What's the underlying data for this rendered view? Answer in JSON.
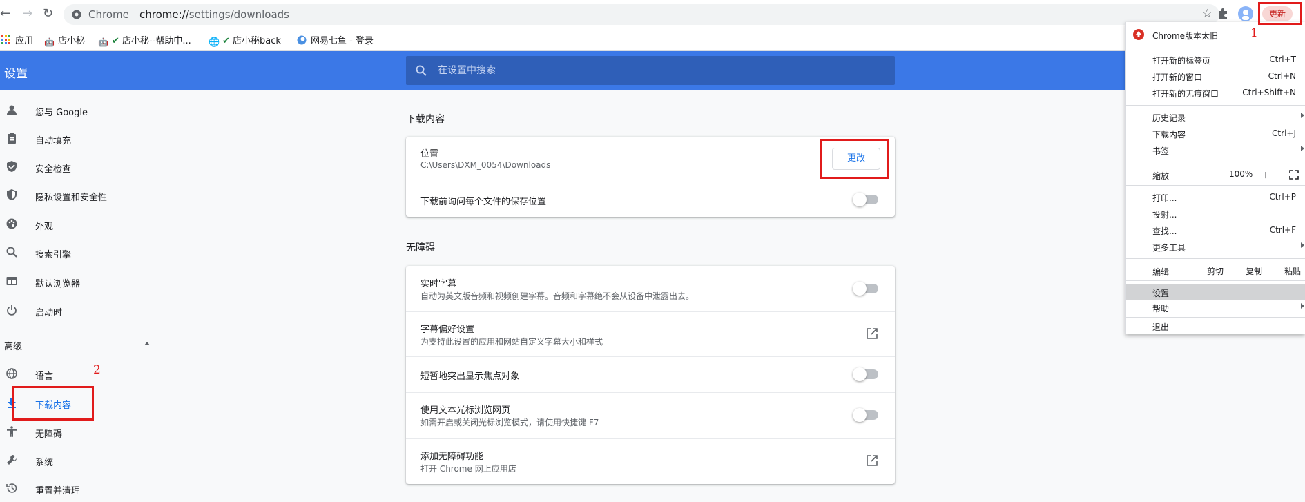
{
  "browser": {
    "site_label": "Chrome",
    "url_host": "chrome://",
    "url_path": "settings/downloads",
    "update_label": "更新"
  },
  "bookmarks": [
    {
      "label": "应用"
    },
    {
      "label": "店小秘"
    },
    {
      "label": "店小秘--帮助中..."
    },
    {
      "label": "店小秘back"
    },
    {
      "label": "网易七鱼 - 登录"
    }
  ],
  "header": {
    "title": "设置",
    "search_placeholder": "在设置中搜索"
  },
  "sidebar": {
    "items": [
      {
        "label": "您与 Google",
        "icon": "person-icon"
      },
      {
        "label": "自动填充",
        "icon": "clipboard-icon"
      },
      {
        "label": "安全检查",
        "icon": "shield-check-icon"
      },
      {
        "label": "隐私设置和安全性",
        "icon": "shield-icon"
      },
      {
        "label": "外观",
        "icon": "palette-icon"
      },
      {
        "label": "搜索引擎",
        "icon": "search-icon"
      },
      {
        "label": "默认浏览器",
        "icon": "browser-icon"
      },
      {
        "label": "启动时",
        "icon": "power-icon"
      }
    ],
    "advanced_label": "高级",
    "advanced_items": [
      {
        "label": "语言",
        "icon": "globe-icon"
      },
      {
        "label": "下载内容",
        "icon": "download-icon",
        "active": true
      },
      {
        "label": "无障碍",
        "icon": "accessibility-icon"
      },
      {
        "label": "系统",
        "icon": "wrench-icon"
      },
      {
        "label": "重置并清理",
        "icon": "history-icon"
      }
    ]
  },
  "downloads": {
    "section_title": "下载内容",
    "location_title": "位置",
    "location_path": "C:\\Users\\DXM_0054\\Downloads",
    "change_label": "更改",
    "ask_label": "下载前询问每个文件的保存位置"
  },
  "accessibility": {
    "section_title": "无障碍",
    "rows": [
      {
        "title": "实时字幕",
        "sub": "自动为英文版音频和视频创建字幕。音频和字幕绝不会从设备中泄露出去。",
        "control": "toggle"
      },
      {
        "title": "字幕偏好设置",
        "sub": "为支持此设置的应用和网站自定义字幕大小和样式",
        "control": "external"
      },
      {
        "title": "短暂地突出显示焦点对象",
        "sub": "",
        "control": "toggle"
      },
      {
        "title": "使用文本光标浏览网页",
        "sub": "如需开启或关闭光标浏览模式，请使用快捷键 F7",
        "control": "toggle"
      },
      {
        "title": "添加无障碍功能",
        "sub": "打开 Chrome 网上应用店",
        "control": "external"
      }
    ]
  },
  "menu": {
    "update_notice": "Chrome版本太旧",
    "new_tab": "打开新的标签页",
    "new_tab_sc": "Ctrl+T",
    "new_window": "打开新的窗口",
    "new_window_sc": "Ctrl+N",
    "incognito": "打开新的无痕窗口",
    "incognito_sc": "Ctrl+Shift+N",
    "history": "历史记录",
    "downloads": "下载内容",
    "downloads_sc": "Ctrl+J",
    "bookmarks": "书签",
    "zoom": "缩放",
    "zoom_minus": "－",
    "zoom_value": "100%",
    "zoom_plus": "＋",
    "print": "打印...",
    "print_sc": "Ctrl+P",
    "cast": "投射...",
    "find": "查找...",
    "find_sc": "Ctrl+F",
    "more_tools": "更多工具",
    "edit": "编辑",
    "cut": "剪切",
    "copy": "复制",
    "paste": "粘贴",
    "settings": "设置",
    "help": "帮助",
    "exit": "退出"
  },
  "annotations": {
    "label_1": "1",
    "label_2": "2"
  },
  "colors": {
    "header_blue": "#3b78e7",
    "accent": "#1a73e8",
    "annotation_red": "#e11b1b"
  }
}
